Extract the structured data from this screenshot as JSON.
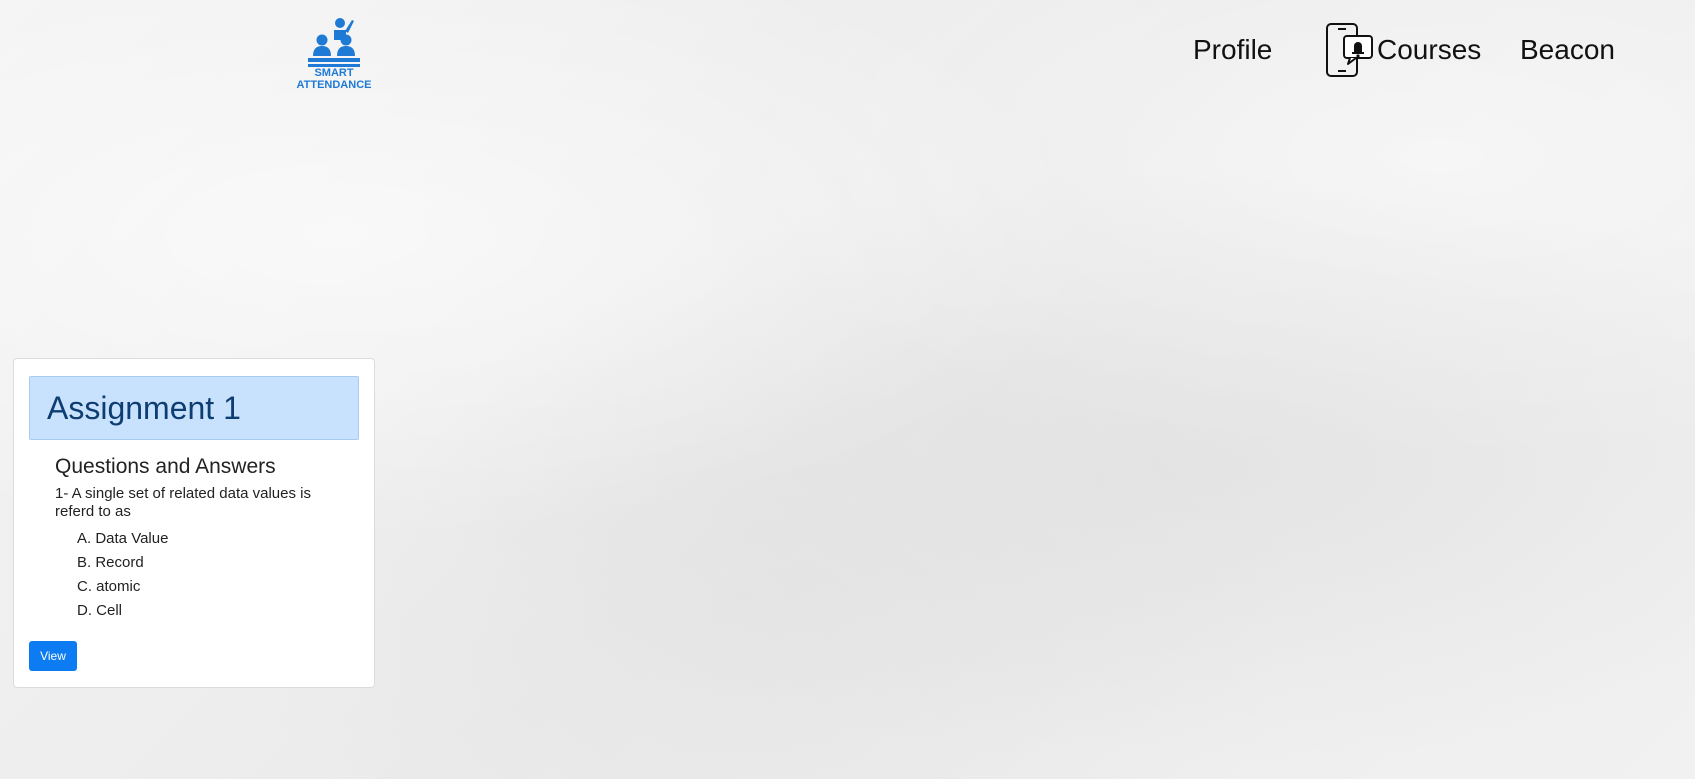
{
  "brand": {
    "logo_line1": "SMART",
    "logo_line2": "ATTENDANCE",
    "logo_color": "#1f7ad6",
    "logo_icon": "classroom-people-icon"
  },
  "nav": {
    "profile_label": "Profile",
    "courses_icon": "mobile-notification-icon",
    "courses_label": "Courses",
    "beacon_label": "Beacon"
  },
  "assignment_card": {
    "title": "Assignment 1",
    "section_title": "Questions and Answers",
    "question": "1- A single set of related data values is referd to as",
    "options": [
      "A. Data Value",
      "B. Record",
      "C. atomic",
      "D. Cell"
    ],
    "view_button_label": "View",
    "header_bg": "#c8e2fd",
    "button_color": "#0d7cf2"
  }
}
